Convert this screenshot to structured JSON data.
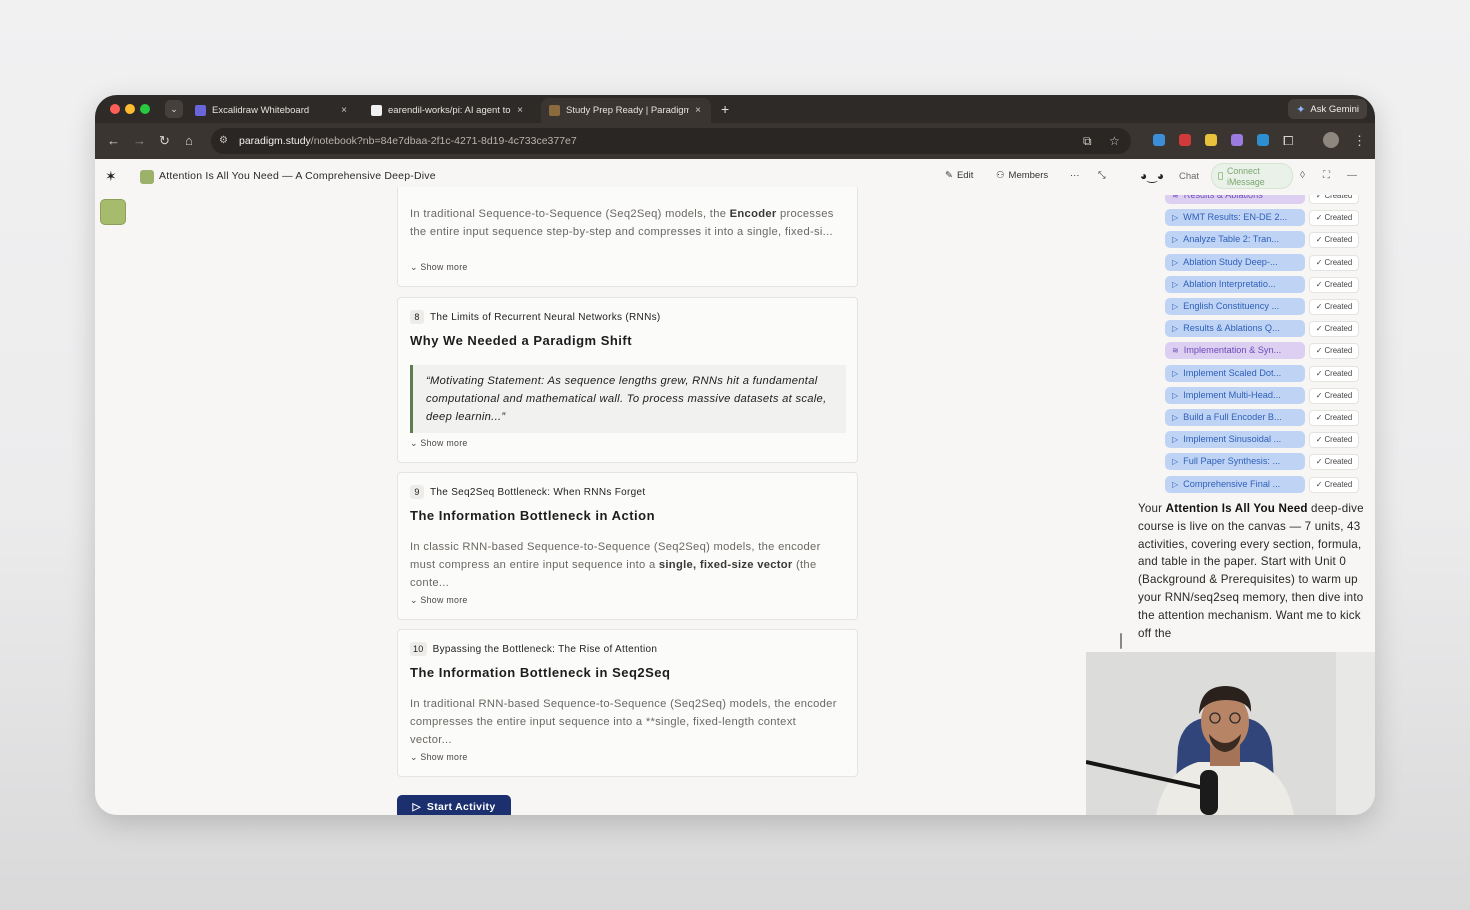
{
  "browser": {
    "tabs": [
      {
        "label": "Excalidraw Whiteboard",
        "close": "×"
      },
      {
        "label": "earendil-works/pi: AI agent to",
        "close": "×"
      },
      {
        "label": "Study Prep Ready | Paradigm",
        "close": "×"
      }
    ],
    "new_tab": "+",
    "tab_menu": "⌄",
    "ask_gemini": "Ask Gemini",
    "url_domain": "paradigm.study",
    "url_path": "/notebook?nb=84e7dbaa-2f1c-4271-8d19-4c733ce377e7"
  },
  "app": {
    "notebook_title": "Attention Is All You Need — A Comprehensive Deep-Dive",
    "edit_label": "Edit",
    "members_label": "Members",
    "more_label": "···"
  },
  "cards": [
    {
      "body_pre": "In traditional Sequence-to-Sequence (Seq2Seq) models, the ",
      "body_bold": "Encoder",
      "body_post": " processes the entire input sequence step-by-step and compresses it into a single, fixed-si...",
      "show_more": "Show more"
    },
    {
      "number": "8",
      "heading": "The Limits of Recurrent Neural Networks (RNNs)",
      "title": "Why We Needed a Paradigm Shift",
      "quote": "“Motivating Statement: As sequence lengths grew, RNNs hit a fundamental computational and mathematical wall. To process massive datasets at scale, deep learnin...”",
      "show_more": "Show more"
    },
    {
      "number": "9",
      "heading": "The Seq2Seq Bottleneck: When RNNs Forget",
      "title": "The Information Bottleneck in Action",
      "body_pre": "In classic RNN-based Sequence-to-Sequence (Seq2Seq) models, the encoder must compress an entire input sequence into a ",
      "body_bold": "single, fixed-size vector",
      "body_post": " (the conte...",
      "show_more": "Show more"
    },
    {
      "number": "10",
      "heading": "Bypassing the Bottleneck: The Rise of Attention",
      "title": "The Information Bottleneck in Seq2Seq",
      "body": "In traditional RNN-based Sequence-to-Sequence (Seq2Seq) models, the encoder compresses the entire input sequence into a **single, fixed-length context vector...",
      "show_more": "Show more"
    }
  ],
  "start_activity": "Start Activity",
  "chat_panel": {
    "chat_label": "Chat",
    "connect_label": "Connect iMessage",
    "items": [
      {
        "label": "Results & Ablations",
        "status": "Created",
        "kind": "unit"
      },
      {
        "label": "WMT Results: EN-DE 2...",
        "status": "Created",
        "kind": "activity"
      },
      {
        "label": "Analyze Table 2: Tran...",
        "status": "Created",
        "kind": "activity"
      },
      {
        "label": "Ablation Study Deep-...",
        "status": "Created",
        "kind": "activity"
      },
      {
        "label": "Ablation Interpretatio...",
        "status": "Created",
        "kind": "activity"
      },
      {
        "label": "English Constituency ...",
        "status": "Created",
        "kind": "activity"
      },
      {
        "label": "Results & Ablations Q...",
        "status": "Created",
        "kind": "activity"
      },
      {
        "label": "Implementation & Syn...",
        "status": "Created",
        "kind": "unit"
      },
      {
        "label": "Implement Scaled Dot...",
        "status": "Created",
        "kind": "activity"
      },
      {
        "label": "Implement Multi-Head...",
        "status": "Created",
        "kind": "activity"
      },
      {
        "label": "Build a Full Encoder B...",
        "status": "Created",
        "kind": "activity"
      },
      {
        "label": "Implement Sinusoidal ...",
        "status": "Created",
        "kind": "activity"
      },
      {
        "label": "Full Paper Synthesis: ...",
        "status": "Created",
        "kind": "activity"
      },
      {
        "label": "Comprehensive Final ...",
        "status": "Created",
        "kind": "activity"
      }
    ],
    "message_pre": "Your ",
    "message_bold": "Attention Is All You Need",
    "message_post": " deep-dive course is live on the canvas — 7 units, 43 activities, covering every section, formula, and table in the paper. Start with Unit 0 (Background & Prerequisites) to warm up your RNN/seq2seq memory, then dive into the attention mechanism. Want me to kick off the"
  },
  "colors": {
    "accent_blue": "#2f5fb8",
    "pill_blue": "#bfd4f5",
    "pill_purple": "#dccff2",
    "start_button": "#1c2f6e",
    "quote_bar": "#5d7e4c"
  }
}
